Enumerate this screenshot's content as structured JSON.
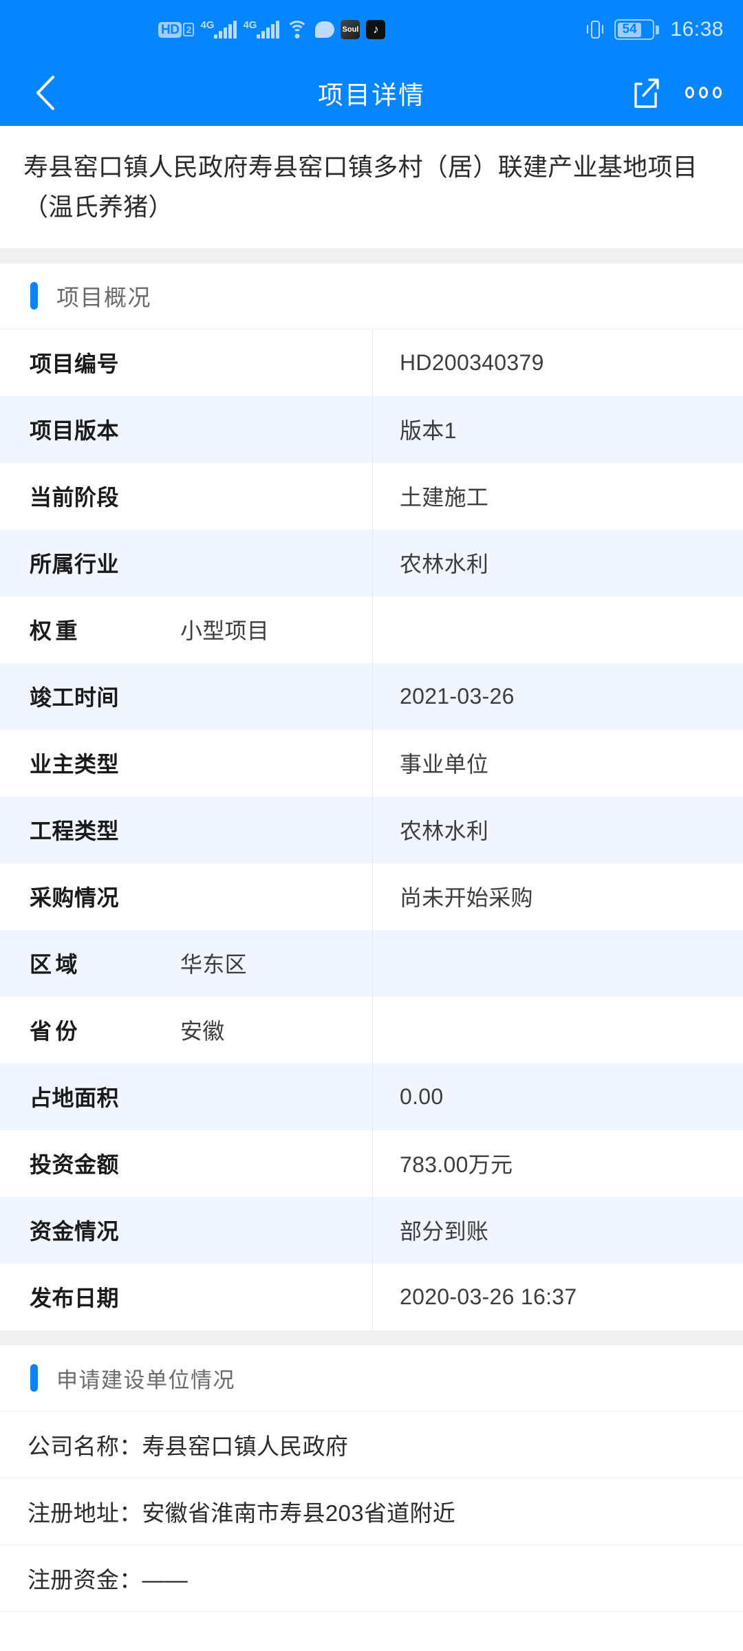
{
  "status_bar": {
    "hd_label": "HD",
    "sim_number": "2",
    "network_1": "4G",
    "network_2": "4G",
    "icons": [
      "hd-icon",
      "signal-4g-icon",
      "signal-4g-icon",
      "wifi-icon",
      "message-bubble-icon",
      "soul-app-icon",
      "tiktok-app-icon",
      "vibrate-icon",
      "battery-icon"
    ],
    "soul_label": "Soul",
    "tiktok_label": "♪",
    "battery_percent": "54",
    "time": "16:38"
  },
  "nav": {
    "title": "项目详情",
    "back_icon": "back-chevron-icon",
    "share_icon": "share-icon",
    "more_icon": "more-dots-icon"
  },
  "project": {
    "title": "寿县窑口镇人民政府寿县窑口镇多村（居）联建产业基地项目（温氏养猪）"
  },
  "overview": {
    "section_title": "项目概况",
    "rows": [
      {
        "key": "项目编号",
        "value": "HD200340379",
        "spread": false
      },
      {
        "key": "项目版本",
        "value": "版本1",
        "spread": false
      },
      {
        "key": "当前阶段",
        "value": "土建施工",
        "spread": false
      },
      {
        "key": "所属行业",
        "value": "农林水利",
        "spread": false
      },
      {
        "key": "权重",
        "value": "小型项目",
        "spread": true
      },
      {
        "key": "竣工时间",
        "value": "2021-03-26",
        "spread": false
      },
      {
        "key": "业主类型",
        "value": "事业单位",
        "spread": false
      },
      {
        "key": "工程类型",
        "value": "农林水利",
        "spread": false
      },
      {
        "key": "采购情况",
        "value": "尚未开始采购",
        "spread": false
      },
      {
        "key": "区域",
        "value": "华东区",
        "spread": true
      },
      {
        "key": "省份",
        "value": "安徽",
        "spread": true
      },
      {
        "key": "占地面积",
        "value": "0.00",
        "spread": false
      },
      {
        "key": "投资金额",
        "value": "783.00万元",
        "spread": false
      },
      {
        "key": "资金情况",
        "value": "部分到账",
        "spread": false
      },
      {
        "key": "发布日期",
        "value": "2020-03-26 16:37",
        "spread": false
      }
    ]
  },
  "applicant": {
    "section_title": "申请建设单位情况",
    "lines": [
      "公司名称：寿县窑口镇人民政府",
      "注册地址：安徽省淮南市寿县203省道附近",
      "注册资金：——"
    ]
  },
  "colors": {
    "header_blue": "#0585FF",
    "accent_blue": "#0c82f5",
    "row_alt": "#f1f5fd",
    "gap_gray": "#f0f0f0"
  }
}
